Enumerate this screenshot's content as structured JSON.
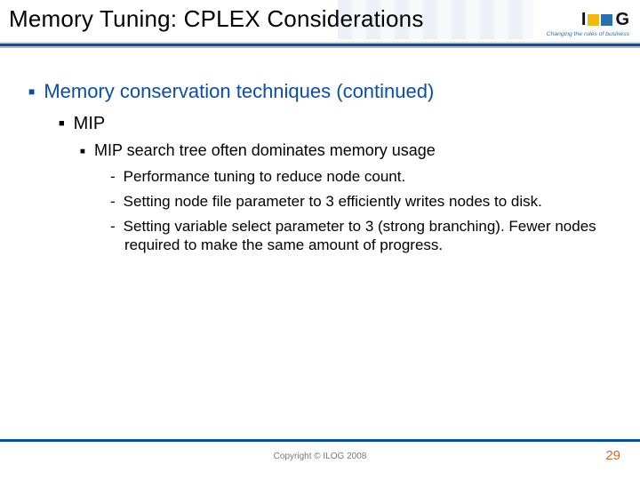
{
  "header": {
    "title": "Memory Tuning: CPLEX Considerations",
    "logo": {
      "letters_left": "I",
      "letters_right": "G",
      "tagline": "Changing the rules of business"
    }
  },
  "body": {
    "lvl1": "Memory conservation techniques (continued)",
    "lvl2": "MIP",
    "lvl3": "MIP search tree often dominates memory usage",
    "lvl4": [
      "Performance tuning  to reduce node count.",
      "Setting node file parameter to 3 efficiently writes nodes to disk.",
      "Setting variable select parameter to 3 (strong branching). Fewer nodes required to make the same amount of progress."
    ]
  },
  "footer": {
    "copyright": "Copyright © ILOG 2008",
    "page": "29"
  }
}
